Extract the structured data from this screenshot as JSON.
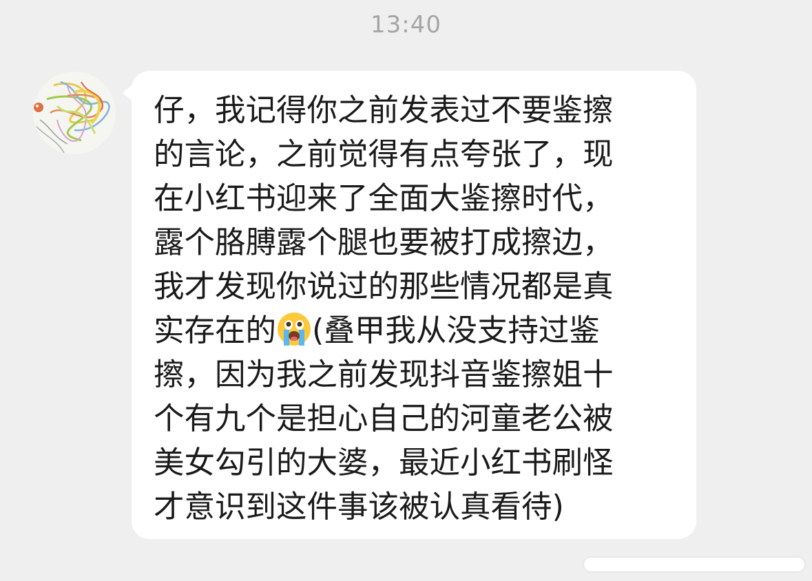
{
  "timestamp": "13:40",
  "sender": {
    "avatar_icon": "scribble-avatar-icon"
  },
  "message": {
    "text_part1": "仔，我记得你之前发表过不要鉴擦\n的言论，之前觉得有点夸张了，现\n在小红书迎来了全面大鉴擦时代，\n露个胳膊露个腿也要被打成擦边，\n我才发现你说过的那些情况都是真\n实存在的",
    "emoji": "loudly-crying-face-icon",
    "text_part2": "(叠甲我从没支持过鉴\n擦，因为我之前发现抖音鉴擦姐十\n个有九个是担心自己的河童老公被\n美女勾引的大婆，最近小红书刷怪\n才意识到这件事该被认真看待)"
  },
  "colors": {
    "background": "#efefef",
    "bubble": "#ffffff",
    "text": "#1a1a1a",
    "timestamp": "#a5a5a5"
  }
}
